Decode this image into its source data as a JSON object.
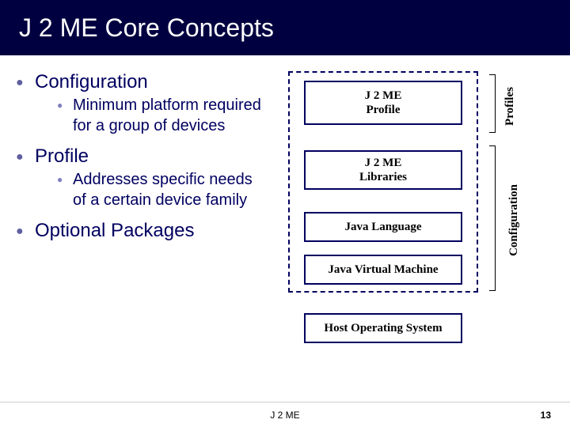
{
  "title": "J 2 ME Core Concepts",
  "bullets": [
    {
      "label": "Configuration",
      "sub": "Minimum platform required for a group of devices"
    },
    {
      "label": "Profile",
      "sub": "Addresses specific needs of a certain device family"
    },
    {
      "label": "Optional Packages",
      "sub": null
    }
  ],
  "diagram": {
    "profile_box": "J 2 ME\nProfile",
    "libraries_box": "J 2 ME\nLibraries",
    "java_lang_box": "Java Language",
    "jvm_box": "Java Virtual Machine",
    "host_box": "Host Operating System",
    "side_label_profiles": "Profiles",
    "side_label_config": "Configuration"
  },
  "footer": {
    "center": "J 2 ME",
    "page": "13"
  }
}
